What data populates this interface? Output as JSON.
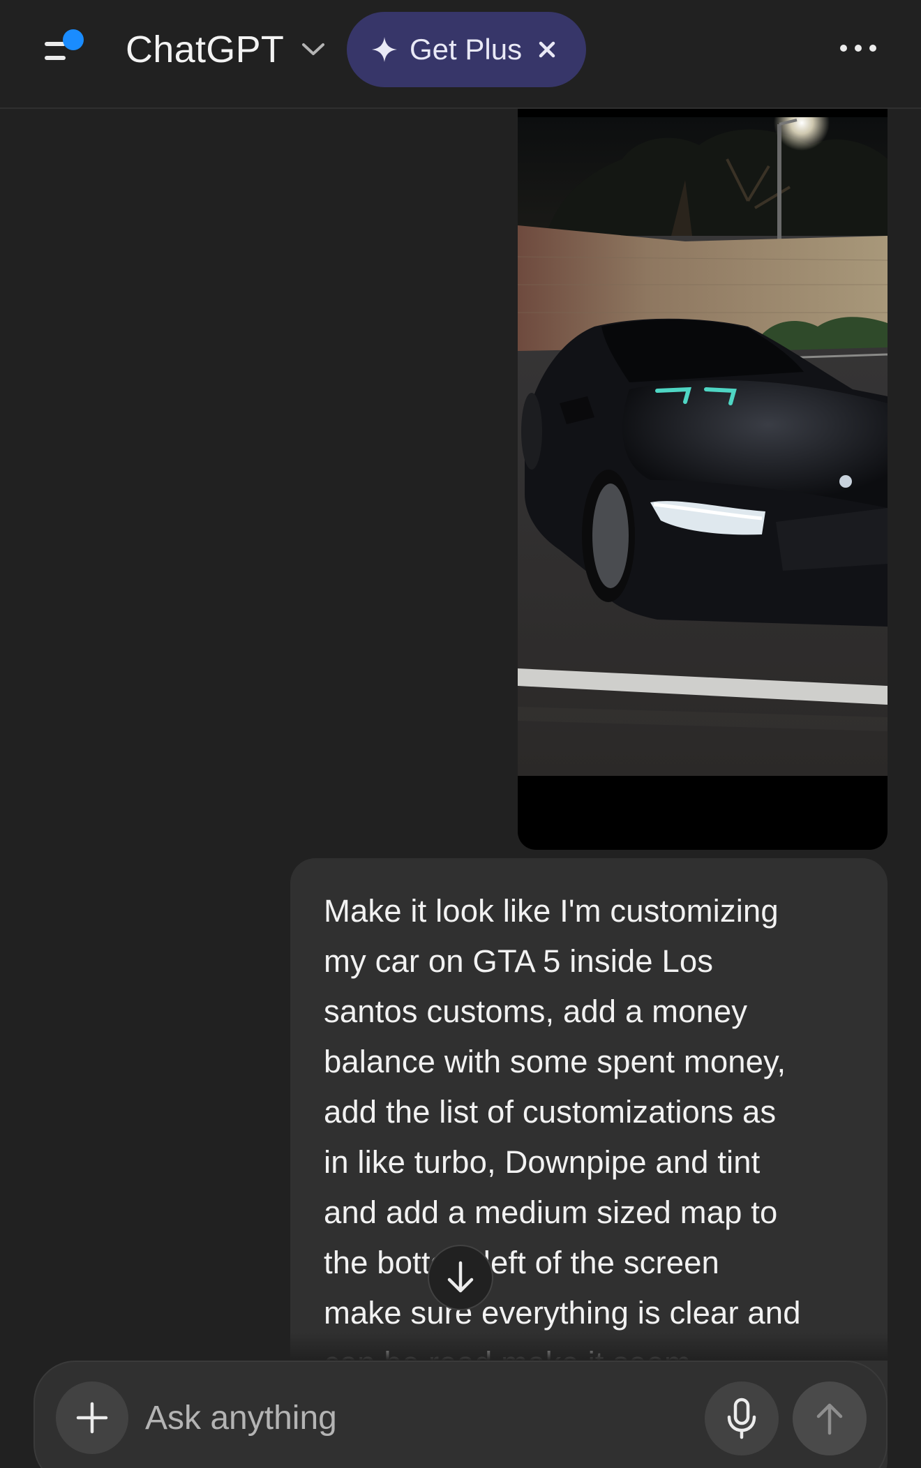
{
  "header": {
    "model_name": "ChatGPT",
    "upgrade_label": "Get Plus",
    "notification_color": "#1a8cff",
    "pill_color": "#373669"
  },
  "conversation": {
    "image_alt": "Black BMW sedan parked at night with headlights on",
    "user_message": "Make it look like I'm customizing\nmy car on GTA 5 inside Los\nsantos customs, add a money\nbalance with some spent money,\nadd the list of customizations as\nin like turbo, Downpipe and tint\nand add a medium sized map to\nthe bottom left of the screen\nmake sure everything is clear and\ncan be read make it seem"
  },
  "composer": {
    "placeholder": "Ask anything"
  }
}
